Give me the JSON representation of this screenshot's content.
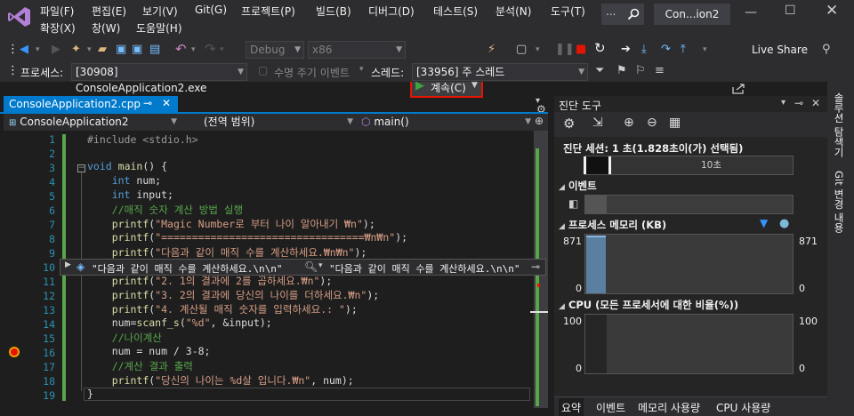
{
  "title_bar": {
    "menu": [
      "파일(F)",
      "편집(E)",
      "보기(V)",
      "Git(G)",
      "프로젝트(P)",
      "빌드(B)",
      "디버그(D)",
      "테스트(S)",
      "분석(N)",
      "도구(T)"
    ],
    "menu_row2": [
      "확장(X)",
      "창(W)",
      "도움말(H)"
    ],
    "search_text": "...",
    "window_title": "Con...ion2"
  },
  "toolbar": {
    "config": "Debug",
    "platform": "x86",
    "continue_label": "계속(C)",
    "live_share": "Live Share"
  },
  "debug_location": {
    "process_label": "프로세스:",
    "process_value": "[30908] ConsoleApplication2.exe",
    "lifecycle_label": "수명 주기 이벤트",
    "thread_label": "스레드:",
    "thread_value": "[33956] 주 스레드"
  },
  "editor": {
    "tab_label": "ConsoleApplication2.cpp",
    "nav_project": "ConsoleApplication2",
    "nav_scope": "(전역 범위)",
    "nav_function": "main()",
    "line_numbers": [
      "1",
      "2",
      "3",
      "4",
      "5",
      "6",
      "7",
      "8",
      "9",
      "10",
      "11",
      "12",
      "13",
      "14",
      "15",
      "16",
      "17",
      "18",
      "19"
    ],
    "datatip_left": "\"다음과 같이 매직 수를 계산하세요.\\n\\n\"",
    "datatip_right": "\"다음과 같이 매직 수를 계산하세요.\\n\\n\""
  },
  "diagnostics": {
    "panel_title": "진단 도구",
    "session": "진단 세션: 1 초(1.828초이(가) 선택됨)",
    "timeline_tick": "10초",
    "events_label": "이벤트",
    "memory_label": "프로세스 메모리 (KB)",
    "memory_max": "871",
    "memory_min": "0",
    "cpu_label": "CPU (모든 프로세서에 대한 비율(%))",
    "cpu_max": "100",
    "cpu_min": "0",
    "tabs": [
      "요약",
      "이벤트",
      "메모리 사용량",
      "CPU 사용량"
    ]
  },
  "side_strip": {
    "item1": "솔루션 탐색기",
    "item2": "Git 변경 내용"
  },
  "colors": {
    "accent": "#007acc",
    "continue_border": "#e51400",
    "string": "#d69d85",
    "keyword": "#569cd6",
    "comment": "#57a64a"
  }
}
